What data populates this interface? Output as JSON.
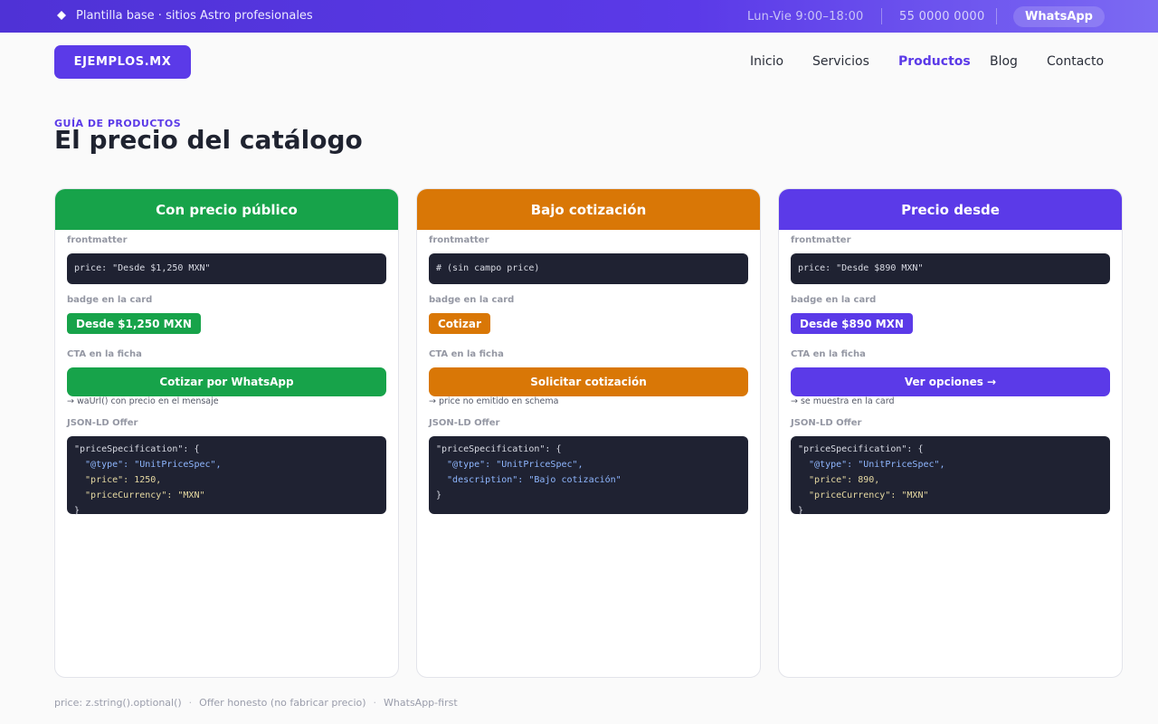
{
  "topbar": {
    "tagline": "Plantilla base · sitios Astro profesionales",
    "hours": "Lun-Vie  9:00–18:00",
    "phone": "55 0000 0000",
    "whatsapp": "WhatsApp"
  },
  "header": {
    "logo": "EJEMPLOS.MX",
    "nav": [
      {
        "label": "Inicio",
        "active": false
      },
      {
        "label": "Servicios",
        "active": false
      },
      {
        "label": "Productos",
        "active": true
      },
      {
        "label": "Blog",
        "active": false
      },
      {
        "label": "Contacto",
        "active": false
      }
    ]
  },
  "page": {
    "eyebrow": "GUÍA DE PRODUCTOS",
    "title": "El precio del catálogo"
  },
  "labels": {
    "frontmatter": "frontmatter",
    "badge": "badge en la card",
    "cta": "CTA en la ficha",
    "jsonld": "JSON-LD Offer"
  },
  "cards": [
    {
      "title": "Con precio público",
      "color": "#17a34a",
      "frontmatter": "price: \"Desde $1,250 MXN\"",
      "badge": "Desde $1,250 MXN",
      "cta": "Cotizar por WhatsApp",
      "note": "→ waUrl() con precio en el mensaje",
      "json": [
        "\"priceSpecification\": {",
        "  \"@type\": \"UnitPriceSpec\",",
        "  \"price\": 1250,",
        "  \"priceCurrency\": \"MXN\"",
        "}"
      ]
    },
    {
      "title": "Bajo cotización",
      "color": "#d97706",
      "frontmatter": "# (sin campo price)",
      "badge": "Cotizar",
      "cta": "Solicitar cotización",
      "note": "→ price no emitido en schema",
      "json": [
        "\"priceSpecification\": {",
        "  \"@type\": \"UnitPriceSpec\",",
        "  \"description\": \"Bajo cotización\"",
        "}"
      ]
    },
    {
      "title": "Precio desde",
      "color": "#5b3ae8",
      "frontmatter": "price: \"Desde $890 MXN\"",
      "badge": "Desde $890 MXN",
      "cta": "Ver opciones →",
      "note": "→ se muestra en la card",
      "json": [
        "\"priceSpecification\": {",
        "  \"@type\": \"UnitPriceSpec\",",
        "  \"price\": 890,",
        "  \"priceCurrency\": \"MXN\"",
        "}"
      ]
    }
  ],
  "footer": [
    "price: z.string().optional()",
    "Offer honesto (no fabricar precio)",
    "WhatsApp-first"
  ]
}
